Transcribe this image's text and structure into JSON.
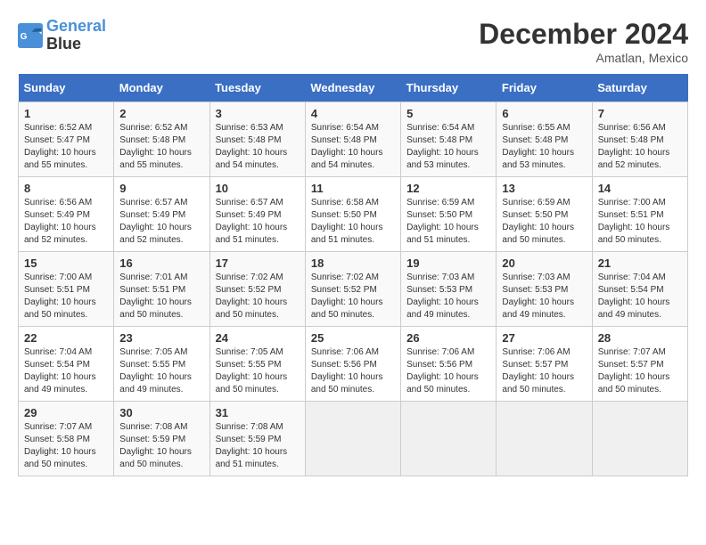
{
  "header": {
    "logo_line1": "General",
    "logo_line2": "Blue",
    "title": "December 2024",
    "location": "Amatlan, Mexico"
  },
  "weekdays": [
    "Sunday",
    "Monday",
    "Tuesday",
    "Wednesday",
    "Thursday",
    "Friday",
    "Saturday"
  ],
  "weeks": [
    [
      {
        "day": "1",
        "info": "Sunrise: 6:52 AM\nSunset: 5:47 PM\nDaylight: 10 hours\nand 55 minutes."
      },
      {
        "day": "2",
        "info": "Sunrise: 6:52 AM\nSunset: 5:48 PM\nDaylight: 10 hours\nand 55 minutes."
      },
      {
        "day": "3",
        "info": "Sunrise: 6:53 AM\nSunset: 5:48 PM\nDaylight: 10 hours\nand 54 minutes."
      },
      {
        "day": "4",
        "info": "Sunrise: 6:54 AM\nSunset: 5:48 PM\nDaylight: 10 hours\nand 54 minutes."
      },
      {
        "day": "5",
        "info": "Sunrise: 6:54 AM\nSunset: 5:48 PM\nDaylight: 10 hours\nand 53 minutes."
      },
      {
        "day": "6",
        "info": "Sunrise: 6:55 AM\nSunset: 5:48 PM\nDaylight: 10 hours\nand 53 minutes."
      },
      {
        "day": "7",
        "info": "Sunrise: 6:56 AM\nSunset: 5:48 PM\nDaylight: 10 hours\nand 52 minutes."
      }
    ],
    [
      {
        "day": "8",
        "info": "Sunrise: 6:56 AM\nSunset: 5:49 PM\nDaylight: 10 hours\nand 52 minutes."
      },
      {
        "day": "9",
        "info": "Sunrise: 6:57 AM\nSunset: 5:49 PM\nDaylight: 10 hours\nand 52 minutes."
      },
      {
        "day": "10",
        "info": "Sunrise: 6:57 AM\nSunset: 5:49 PM\nDaylight: 10 hours\nand 51 minutes."
      },
      {
        "day": "11",
        "info": "Sunrise: 6:58 AM\nSunset: 5:50 PM\nDaylight: 10 hours\nand 51 minutes."
      },
      {
        "day": "12",
        "info": "Sunrise: 6:59 AM\nSunset: 5:50 PM\nDaylight: 10 hours\nand 51 minutes."
      },
      {
        "day": "13",
        "info": "Sunrise: 6:59 AM\nSunset: 5:50 PM\nDaylight: 10 hours\nand 50 minutes."
      },
      {
        "day": "14",
        "info": "Sunrise: 7:00 AM\nSunset: 5:51 PM\nDaylight: 10 hours\nand 50 minutes."
      }
    ],
    [
      {
        "day": "15",
        "info": "Sunrise: 7:00 AM\nSunset: 5:51 PM\nDaylight: 10 hours\nand 50 minutes."
      },
      {
        "day": "16",
        "info": "Sunrise: 7:01 AM\nSunset: 5:51 PM\nDaylight: 10 hours\nand 50 minutes."
      },
      {
        "day": "17",
        "info": "Sunrise: 7:02 AM\nSunset: 5:52 PM\nDaylight: 10 hours\nand 50 minutes."
      },
      {
        "day": "18",
        "info": "Sunrise: 7:02 AM\nSunset: 5:52 PM\nDaylight: 10 hours\nand 50 minutes."
      },
      {
        "day": "19",
        "info": "Sunrise: 7:03 AM\nSunset: 5:53 PM\nDaylight: 10 hours\nand 49 minutes."
      },
      {
        "day": "20",
        "info": "Sunrise: 7:03 AM\nSunset: 5:53 PM\nDaylight: 10 hours\nand 49 minutes."
      },
      {
        "day": "21",
        "info": "Sunrise: 7:04 AM\nSunset: 5:54 PM\nDaylight: 10 hours\nand 49 minutes."
      }
    ],
    [
      {
        "day": "22",
        "info": "Sunrise: 7:04 AM\nSunset: 5:54 PM\nDaylight: 10 hours\nand 49 minutes."
      },
      {
        "day": "23",
        "info": "Sunrise: 7:05 AM\nSunset: 5:55 PM\nDaylight: 10 hours\nand 49 minutes."
      },
      {
        "day": "24",
        "info": "Sunrise: 7:05 AM\nSunset: 5:55 PM\nDaylight: 10 hours\nand 50 minutes."
      },
      {
        "day": "25",
        "info": "Sunrise: 7:06 AM\nSunset: 5:56 PM\nDaylight: 10 hours\nand 50 minutes."
      },
      {
        "day": "26",
        "info": "Sunrise: 7:06 AM\nSunset: 5:56 PM\nDaylight: 10 hours\nand 50 minutes."
      },
      {
        "day": "27",
        "info": "Sunrise: 7:06 AM\nSunset: 5:57 PM\nDaylight: 10 hours\nand 50 minutes."
      },
      {
        "day": "28",
        "info": "Sunrise: 7:07 AM\nSunset: 5:57 PM\nDaylight: 10 hours\nand 50 minutes."
      }
    ],
    [
      {
        "day": "29",
        "info": "Sunrise: 7:07 AM\nSunset: 5:58 PM\nDaylight: 10 hours\nand 50 minutes."
      },
      {
        "day": "30",
        "info": "Sunrise: 7:08 AM\nSunset: 5:59 PM\nDaylight: 10 hours\nand 50 minutes."
      },
      {
        "day": "31",
        "info": "Sunrise: 7:08 AM\nSunset: 5:59 PM\nDaylight: 10 hours\nand 51 minutes."
      },
      {
        "day": "",
        "info": ""
      },
      {
        "day": "",
        "info": ""
      },
      {
        "day": "",
        "info": ""
      },
      {
        "day": "",
        "info": ""
      }
    ]
  ]
}
